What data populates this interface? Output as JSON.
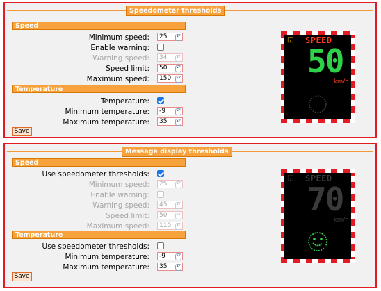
{
  "panel1": {
    "title": "Speedometer thresholds",
    "speed_header": "Speed",
    "rows": [
      {
        "label": "Minimum speed:",
        "value": "25"
      },
      {
        "label": "Enable warning:",
        "checked": false
      },
      {
        "label": "Warning speed:",
        "value": "34",
        "disabled": true
      },
      {
        "label": "Speed limit:",
        "value": "50"
      },
      {
        "label": "Maximum speed:",
        "value": "150"
      }
    ],
    "temp_header": "Temperature",
    "temp_rows": [
      {
        "label": "Temperature:",
        "checked": true
      },
      {
        "label": "Minimum temperature:",
        "value": "-9"
      },
      {
        "label": "Maximum temperature:",
        "value": "35"
      }
    ],
    "save_label": "Save",
    "sign": {
      "word": "SPEED",
      "value": "50",
      "unit": "km/h",
      "word_color": "#ff3b1f",
      "value_color": "#2fd14a",
      "unit_color": "#ff3b1f"
    }
  },
  "panel2": {
    "title": "Message display thresholds",
    "speed_header": "Speed",
    "rows": [
      {
        "label": "Use speedometer thresholds:",
        "checked": true
      },
      {
        "label": "Minimum speed:",
        "value": "25",
        "disabled": true
      },
      {
        "label": "Enable warning:",
        "checked": false,
        "disabled": true
      },
      {
        "label": "Warning speed:",
        "value": "45",
        "disabled": true
      },
      {
        "label": "Speed limit:",
        "value": "50",
        "disabled": true
      },
      {
        "label": "Maximum speed:",
        "value": "110",
        "disabled": true
      }
    ],
    "temp_header": "Temperature",
    "temp_rows": [
      {
        "label": "Use speedometer thresholds:",
        "checked": false
      },
      {
        "label": "Minimum temperature:",
        "value": "-9"
      },
      {
        "label": "Maximum temperature:",
        "value": "35"
      }
    ],
    "save_label": "Save",
    "sign": {
      "word": "SPEED",
      "value": "70",
      "unit": "km/h",
      "word_color": "#3a3a3a",
      "value_color": "#3a3a3a",
      "unit_color": "#3a3a3a",
      "smiley_color": "#2fd14a"
    }
  }
}
